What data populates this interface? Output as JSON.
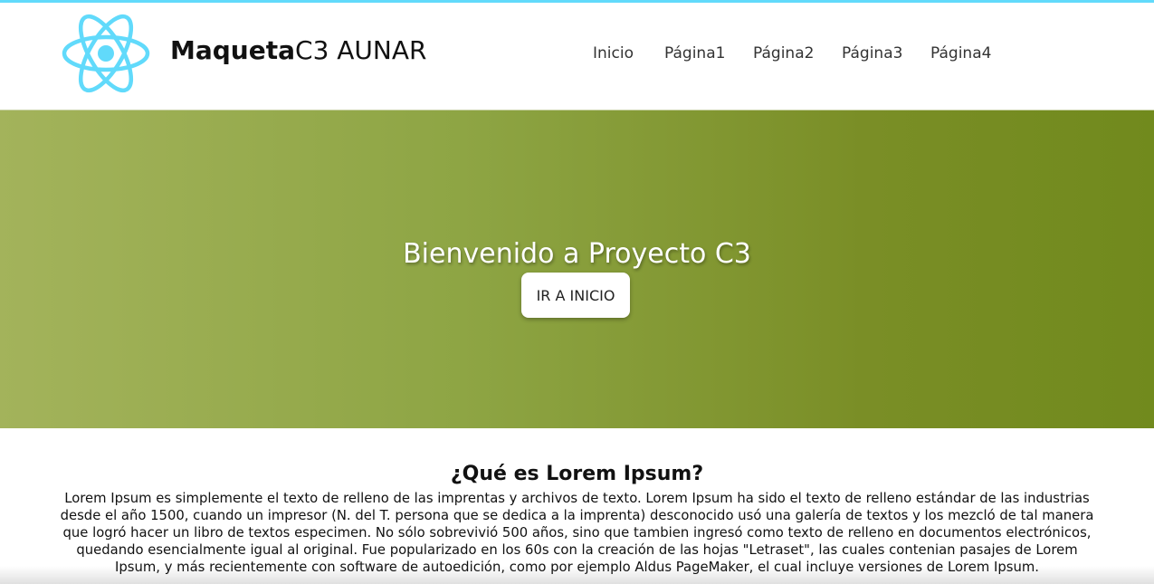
{
  "header": {
    "brand_bold": "Maqueta",
    "brand_regular": "C3 AUNAR",
    "logo_icon": "react-atom-logo",
    "nav": [
      {
        "label": "Inicio"
      },
      {
        "label": "Página1"
      },
      {
        "label": "Página2"
      },
      {
        "label": "Página3"
      },
      {
        "label": "Página4"
      }
    ]
  },
  "hero": {
    "title": "Bienvenido a Proyecto C3",
    "button_label": "IR A INICIO"
  },
  "content": {
    "title": "¿Qué es Lorem Ipsum?",
    "body": "Lorem Ipsum es simplemente el texto de relleno de las imprentas y archivos de texto. Lorem Ipsum ha sido el texto de relleno estándar de las industrias desde el año 1500, cuando un impresor (N. del T. persona que se dedica a la imprenta) desconocido usó una galería de textos y los mezcló de tal manera que logró hacer un libro de textos especimen. No sólo sobrevivió 500 años, sino que tambien ingresó como texto de relleno en documentos electrónicos, quedando esencialmente igual al original. Fue popularizado en los 60s con la creación de las hojas \"Letraset\", las cuales contenian pasajes de Lorem Ipsum, y más recientemente con software de autoedición, como por ejemplo Aldus PageMaker, el cual incluye versiones de Lorem Ipsum."
  },
  "colors": {
    "accent": "#61dafb",
    "hero_start": "#a3b35b",
    "hero_end": "#718a1d"
  }
}
